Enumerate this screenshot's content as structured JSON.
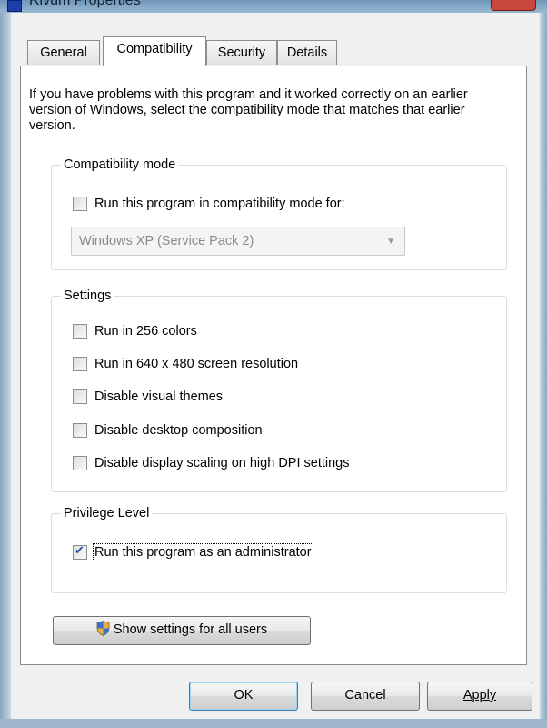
{
  "window": {
    "title": "Rivum Properties"
  },
  "tabs": [
    {
      "label": "General",
      "active": false
    },
    {
      "label": "Compatibility",
      "active": true
    },
    {
      "label": "Security",
      "active": false
    },
    {
      "label": "Details",
      "active": false
    }
  ],
  "intro_text": "If you have problems with this program and it worked correctly on an earlier version of Windows, select the compatibility mode that matches that earlier version.",
  "compat_mode": {
    "title": "Compatibility mode",
    "checkbox_label": "Run this program in compatibility mode for:",
    "checked": false,
    "dropdown_value": "Windows XP (Service Pack 2)"
  },
  "settings": {
    "title": "Settings",
    "items": [
      {
        "label": "Run in 256 colors",
        "checked": false
      },
      {
        "label": "Run in 640 x 480 screen resolution",
        "checked": false
      },
      {
        "label": "Disable visual themes",
        "checked": false
      },
      {
        "label": "Disable desktop composition",
        "checked": false
      },
      {
        "label": "Disable display scaling on high DPI settings",
        "checked": false
      }
    ]
  },
  "privilege": {
    "title": "Privilege Level",
    "checkbox_label": "Run this program as an administrator",
    "checked": true
  },
  "show_all_users_label": "Show settings for all users",
  "buttons": {
    "ok": "OK",
    "cancel": "Cancel",
    "apply": "Apply"
  },
  "colors": {
    "panel_bg": "#ffffff",
    "dialog_bg": "#f0f0f0",
    "check_color": "#2a4aa8",
    "default_button_border": "#3c7fb1"
  }
}
